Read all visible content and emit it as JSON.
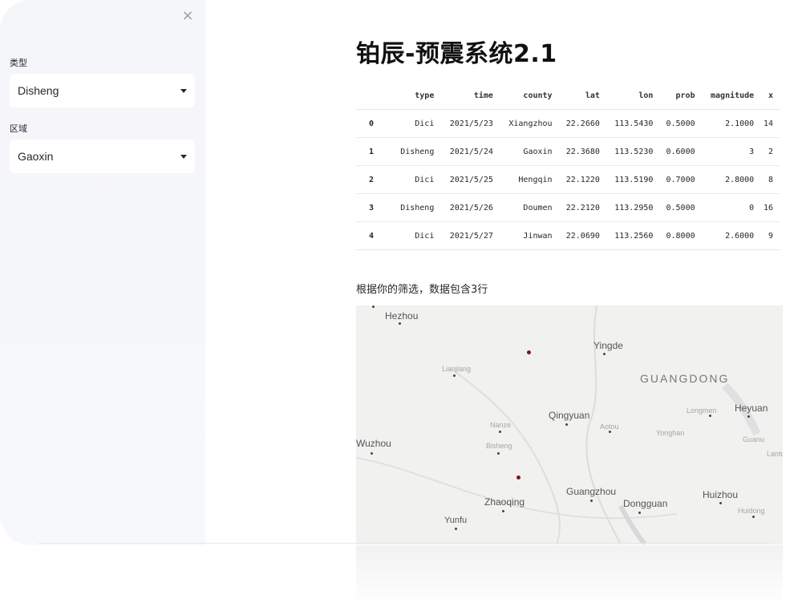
{
  "sidebar": {
    "close_icon": "×",
    "type_label": "类型",
    "type_value": "Disheng",
    "region_label": "区域",
    "region_value": "Gaoxin"
  },
  "main": {
    "title": "铂辰-预震系统2.1",
    "table": {
      "columns": [
        "",
        "type",
        "time",
        "county",
        "lat",
        "lon",
        "prob",
        "magnitude",
        "x"
      ],
      "rows": [
        [
          "0",
          "Dici",
          "2021/5/23",
          "Xiangzhou",
          "22.2660",
          "113.5430",
          "0.5000",
          "2.1000",
          "14"
        ],
        [
          "1",
          "Disheng",
          "2021/5/24",
          "Gaoxin",
          "22.3680",
          "113.5230",
          "0.6000",
          "3",
          "2"
        ],
        [
          "2",
          "Dici",
          "2021/5/25",
          "Hengqin",
          "22.1220",
          "113.5190",
          "0.7000",
          "2.8000",
          "8"
        ],
        [
          "3",
          "Disheng",
          "2021/5/26",
          "Doumen",
          "22.2120",
          "113.2950",
          "0.5000",
          "0",
          "16"
        ],
        [
          "4",
          "Dici",
          "2021/5/27",
          "Jinwan",
          "22.0690",
          "113.2560",
          "0.8000",
          "2.6000",
          "9"
        ]
      ]
    },
    "caption": "根据你的筛选，数据包含3行",
    "map": {
      "province": "GUANGDONG",
      "cities": [
        "Hezhou",
        "Yingde",
        "Qingyuan",
        "Heyuan",
        "Wuzhou",
        "Guangzhou",
        "Zhaoqing",
        "Dongguan",
        "Huizhou",
        "Yunfu"
      ],
      "towns": [
        "Lianjiang",
        "Nanze",
        "Bisheng",
        "Aotou",
        "Yonghan",
        "Longmen",
        "Guanu",
        "Huidong",
        "Lantu"
      ]
    }
  },
  "colors": {
    "sidebar_bg": "#f5f6fa",
    "map_bg": "#f1f1f0",
    "point": "#7a1a1a"
  }
}
